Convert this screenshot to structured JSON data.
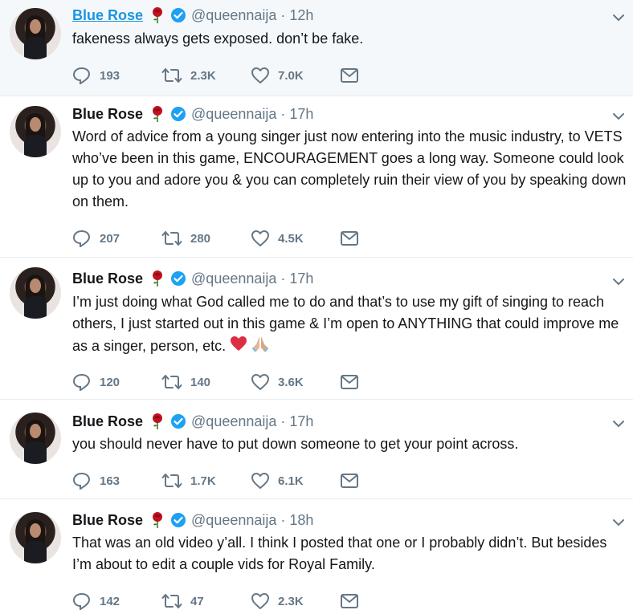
{
  "tweets": [
    {
      "name": "Blue Rose",
      "handle": "@queennaija",
      "separator": "·",
      "time": "12h",
      "text": "fakeness always gets exposed. don’t be fake.",
      "replies": "193",
      "retweets": "2.3K",
      "likes": "7.0K"
    },
    {
      "name": "Blue Rose",
      "handle": "@queennaija",
      "separator": "·",
      "time": "17h",
      "text": "Word of advice from a young singer just now entering into the music industry, to VETS who’ve been in this game, ENCOURAGEMENT goes a long way. Someone could look up to you and adore you & you can completely ruin their view of you by speaking down on them.",
      "replies": "207",
      "retweets": "280",
      "likes": "4.5K"
    },
    {
      "name": "Blue Rose",
      "handle": "@queennaija",
      "separator": "·",
      "time": "17h",
      "text": "I’m just doing what God called me to do and that’s to use my gift of singing to reach others, I just started out in this game & I’m open to ANYTHING that could improve me as a singer, person, etc.",
      "emoji": [
        "red-heart",
        "folded-hands"
      ],
      "replies": "120",
      "retweets": "140",
      "likes": "3.6K"
    },
    {
      "name": "Blue Rose",
      "handle": "@queennaija",
      "separator": "·",
      "time": "17h",
      "text": "you should never have to put down someone to get your point across.",
      "replies": "163",
      "retweets": "1.7K",
      "likes": "6.1K"
    },
    {
      "name": "Blue Rose",
      "handle": "@queennaija",
      "separator": "·",
      "time": "18h",
      "text": "That was an old video y’all. I think I posted that one or I probably didn’t. But besides I’m about to edit a couple vids for Royal Family.",
      "replies": "142",
      "retweets": "47",
      "likes": "2.3K"
    }
  ],
  "colors": {
    "link": "#1b95e0",
    "muted": "#657786",
    "text": "#14171a",
    "verified": "#1da1f2",
    "rose": "#c0111f",
    "highlight_bg": "#f5f8fa",
    "divider": "#e6ecf0"
  },
  "icons": [
    "rose-emoji-icon",
    "verified-badge-icon",
    "chevron-down-icon",
    "reply-icon",
    "retweet-icon",
    "like-icon",
    "direct-message-icon"
  ]
}
